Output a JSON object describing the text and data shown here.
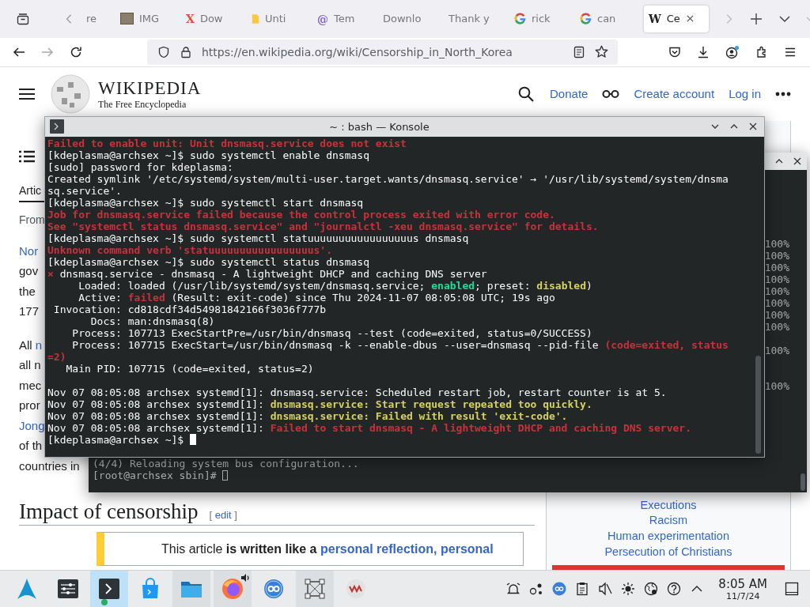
{
  "browser": {
    "tabs": [
      {
        "title": "re",
        "kind": "plain",
        "selected": false
      },
      {
        "title": "IMG",
        "kind": "image",
        "selected": false
      },
      {
        "title": "Dow",
        "kind": "glyph",
        "glyph": "X",
        "color": "#e5533d",
        "selected": false
      },
      {
        "title": "Unti",
        "kind": "doc",
        "selected": false
      },
      {
        "title": "Tem",
        "kind": "glyph",
        "glyph": "@",
        "color": "#7d5fe0",
        "selected": false
      },
      {
        "title": "Downlo",
        "kind": "plain",
        "selected": false
      },
      {
        "title": "Thank y",
        "kind": "plain",
        "selected": false
      },
      {
        "title": "rick",
        "kind": "ring",
        "selected": false
      },
      {
        "title": "can",
        "kind": "ring",
        "selected": false
      },
      {
        "title": "Ce",
        "kind": "glyph",
        "glyph": "W",
        "color": "#202122",
        "selected": true
      }
    ],
    "url": "https://en.wikipedia.org/wiki/Censorship_in_North_Korea"
  },
  "wiki": {
    "logo_title": "WIKIPEDIA",
    "logo_tagline": "The Free Encyclopedia",
    "header_links": [
      {
        "label": "Donate"
      },
      {
        "label": "Create account"
      },
      {
        "label": "Log in"
      }
    ],
    "tab": "Artic",
    "from": "From",
    "paragraphs": [
      [
        [
          {
            "text": "Nor",
            "link": true
          }
        ],
        [
          {
            "text": "gov",
            "link": false
          }
        ],
        [
          {
            "text": "the",
            "link": false
          }
        ],
        [
          {
            "text": "177",
            "link": false
          }
        ]
      ],
      [
        [
          {
            "text": "All ",
            "link": false
          },
          {
            "text": "n",
            "link": true
          }
        ],
        [
          {
            "text": "all n",
            "link": false
          }
        ],
        [
          {
            "text": "mec",
            "link": false
          }
        ],
        [
          {
            "text": "pror",
            "link": false
          }
        ],
        [
          {
            "text": "Jong",
            "link": true
          }
        ],
        [
          {
            "text": "of th",
            "link": false
          }
        ],
        [
          {
            "text": "countries in",
            "link": false
          }
        ]
      ]
    ],
    "heading": "Impact of censorship",
    "edit": {
      "open": "[",
      "label": "edit",
      "close": "]"
    },
    "notice": [
      {
        "text": "This article ",
        "kind": "plain"
      },
      {
        "text": "is written like a ",
        "kind": "bold"
      },
      {
        "text": "personal reflection, personal",
        "kind": "link"
      }
    ],
    "sidebar_links": [
      "Executions",
      "Racism",
      "Human experimentation",
      "Persecution of Christians"
    ]
  },
  "background_terminal": {
    "readings": [
      "100%",
      "100%",
      "100%",
      "100%",
      "100%",
      "100%",
      "100%",
      "100%",
      "100%",
      "100%"
    ],
    "lines": [
      {
        "text": "(4/4) Reloading system bus configuration...",
        "cursor": false
      },
      {
        "text": "[root@archsex sbin]# ",
        "cursor": true
      }
    ]
  },
  "konsole": {
    "title": "~ : bash — Konsole",
    "lines": [
      {
        "segments": [
          {
            "text": "Failed to enable unit: Unit dnsmasq.service does not exist",
            "kind": "error"
          }
        ]
      },
      {
        "segments": [
          {
            "text": "[kdeplasma@archsex ~]$ sudo systemctl enable dnsmasq",
            "kind": "plain"
          }
        ]
      },
      {
        "segments": [
          {
            "text": "[sudo] password for kdeplasma:",
            "kind": "plain"
          }
        ]
      },
      {
        "segments": [
          {
            "text": "Created symlink '/etc/systemd/system/multi-user.target.wants/dnsmasq.service' → '/usr/lib/systemd/system/dnsma",
            "kind": "plain"
          }
        ]
      },
      {
        "segments": [
          {
            "text": "sq.service'.",
            "kind": "plain"
          }
        ]
      },
      {
        "segments": [
          {
            "text": "[kdeplasma@archsex ~]$ sudo systemctl start dnsmasq",
            "kind": "plain"
          }
        ]
      },
      {
        "segments": [
          {
            "text": "Job for dnsmasq.service failed because the control process exited with error code.",
            "kind": "error"
          }
        ]
      },
      {
        "segments": [
          {
            "text": "See \"systemctl status dnsmasq.service\" and \"journalctl -xeu dnsmasq.service\" for details.",
            "kind": "error"
          }
        ]
      },
      {
        "segments": [
          {
            "text": "[kdeplasma@archsex ~]$ sudo systemctl statuuuuuuuuuuuuuuuuus dnsmasq",
            "kind": "plain"
          }
        ]
      },
      {
        "segments": [
          {
            "text": "Unknown command verb 'statuuuuuuuuuuuuuuuuus'.",
            "kind": "error"
          }
        ]
      },
      {
        "segments": [
          {
            "text": "[kdeplasma@archsex ~]$ sudo systemctl status dnsmasq",
            "kind": "plain"
          }
        ]
      },
      {
        "segments": [
          {
            "text": "×",
            "kind": "error"
          },
          {
            "text": " dnsmasq.service - dnsmasq - A lightweight DHCP and caching DNS server",
            "kind": "plain"
          }
        ]
      },
      {
        "segments": [
          {
            "text": "     Loaded: loaded (/usr/lib/systemd/system/dnsmasq.service; ",
            "kind": "plain"
          },
          {
            "text": "enabled",
            "kind": "ok"
          },
          {
            "text": "; preset: ",
            "kind": "plain"
          },
          {
            "text": "disabled",
            "kind": "warn"
          },
          {
            "text": ")",
            "kind": "plain"
          }
        ]
      },
      {
        "segments": [
          {
            "text": "     Active: ",
            "kind": "plain"
          },
          {
            "text": "failed",
            "kind": "error"
          },
          {
            "text": " (Result: exit-code) since Thu 2024-11-07 08:05:08 UTC; 19s ago",
            "kind": "plain"
          }
        ]
      },
      {
        "segments": [
          {
            "text": " Invocation: cd818cdf34d54981842166f3036f777b",
            "kind": "plain"
          }
        ]
      },
      {
        "segments": [
          {
            "text": "       Docs: man:dnsmasq(8)",
            "kind": "plain"
          }
        ]
      },
      {
        "segments": [
          {
            "text": "    Process: 107713 ExecStartPre=/usr/bin/dnsmasq --test (code=exited, status=0/SUCCESS)",
            "kind": "plain"
          }
        ]
      },
      {
        "segments": [
          {
            "text": "    Process: 107715 ExecStart=/usr/bin/dnsmasq -k --enable-dbus --user=dnsmasq --pid-file ",
            "kind": "plain"
          },
          {
            "text": "(code=exited, status",
            "kind": "error"
          }
        ]
      },
      {
        "segments": [
          {
            "text": "=2)",
            "kind": "error"
          }
        ]
      },
      {
        "segments": [
          {
            "text": "   Main PID: 107715 (code=exited, status=2)",
            "kind": "plain"
          }
        ]
      },
      {
        "blank_before": true,
        "segments": [
          {
            "text": "Nov 07 08:05:08 archsex systemd[1]: dnsmasq.service: Scheduled restart job, restart counter is at 5.",
            "kind": "plain"
          }
        ]
      },
      {
        "segments": [
          {
            "text": "Nov 07 08:05:08 archsex systemd[1]: ",
            "kind": "plain"
          },
          {
            "text": "dnsmasq.service: Start request repeated too quickly.",
            "kind": "warn"
          }
        ]
      },
      {
        "segments": [
          {
            "text": "Nov 07 08:05:08 archsex systemd[1]: ",
            "kind": "plain"
          },
          {
            "text": "dnsmasq.service: Failed with result 'exit-code'.",
            "kind": "warn"
          }
        ]
      },
      {
        "segments": [
          {
            "text": "Nov 07 08:05:08 archsex systemd[1]: ",
            "kind": "plain"
          },
          {
            "text": "Failed to start dnsmasq - A lightweight DHCP and caching DNS server.",
            "kind": "error"
          }
        ]
      },
      {
        "cursor": true,
        "segments": [
          {
            "text": "[kdeplasma@archsex ~]$ ",
            "kind": "plain"
          }
        ]
      }
    ]
  },
  "taskbar": {
    "apps": [
      {
        "kind": "launcher",
        "active": false,
        "running": false,
        "audio": false,
        "badge": false
      },
      {
        "kind": "settings",
        "active": false,
        "running": false,
        "audio": false,
        "badge": false
      },
      {
        "kind": "terminal",
        "active": true,
        "running": true,
        "audio": false,
        "badge": true
      },
      {
        "kind": "store",
        "active": false,
        "running": false,
        "audio": false,
        "badge": false
      },
      {
        "kind": "files",
        "active": false,
        "running": true,
        "audio": false,
        "badge": false
      },
      {
        "kind": "browser",
        "active": false,
        "running": true,
        "audio": true,
        "badge": false
      },
      {
        "kind": "torrent",
        "active": false,
        "running": false,
        "audio": false,
        "badge": false
      },
      {
        "kind": "screenshot",
        "active": false,
        "running": true,
        "audio": false,
        "badge": false
      },
      {
        "kind": "vm",
        "active": false,
        "running": false,
        "audio": false,
        "badge": false
      }
    ],
    "tray": [
      {
        "kind": "alarm"
      },
      {
        "kind": "connect"
      },
      {
        "kind": "torrent"
      },
      {
        "kind": "clipboard"
      },
      {
        "kind": "muted"
      },
      {
        "kind": "brightness"
      },
      {
        "kind": "network"
      },
      {
        "kind": "help"
      },
      {
        "kind": "expand"
      }
    ],
    "time": "8:05 AM",
    "date": "11/7/24"
  }
}
